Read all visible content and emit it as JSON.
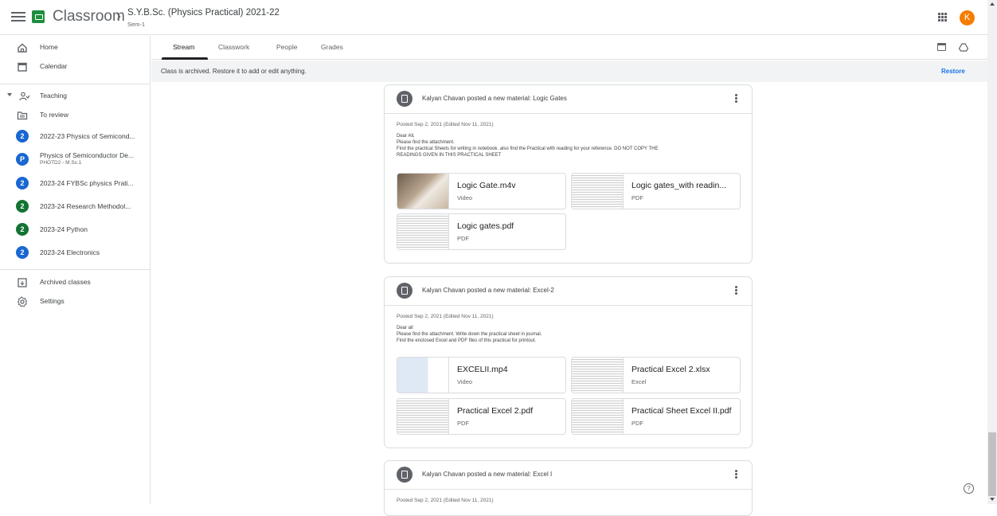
{
  "header": {
    "brand": "Classroom",
    "separator": "›",
    "class_title": "S.Y.B.Sc. (Physics Practical) 2021-22",
    "class_section": "Sem-1",
    "avatar_letter": "K",
    "avatar_color": "#f57c00"
  },
  "sidebar": {
    "home": "Home",
    "calendar": "Calendar",
    "teaching": "Teaching",
    "to_review": "To review",
    "classes": [
      {
        "badge": "2",
        "color": "#1967d2",
        "label": "2022-23 Physics of Semicond...",
        "sub": ""
      },
      {
        "badge": "P",
        "color": "#1967d2",
        "label": "Physics of Semiconductor De...",
        "sub": "PHOTD2 - M.Sc.1"
      },
      {
        "badge": "2",
        "color": "#1967d2",
        "label": "2023-24 FYBSc physics Prati...",
        "sub": ""
      },
      {
        "badge": "2",
        "color": "#137333",
        "label": "2023-24 Research Methodol...",
        "sub": ""
      },
      {
        "badge": "2",
        "color": "#137333",
        "label": "2023-24 Python",
        "sub": ""
      },
      {
        "badge": "2",
        "color": "#1967d2",
        "label": "2023-24 Electronics",
        "sub": ""
      }
    ],
    "archived": "Archived classes",
    "settings": "Settings"
  },
  "tabs": {
    "stream": "Stream",
    "classwork": "Classwork",
    "people": "People",
    "grades": "Grades"
  },
  "banner": {
    "text": "Class is archived. Restore it to add or edit anything.",
    "restore": "Restore"
  },
  "posts": [
    {
      "title": "Kalyan Chavan posted a new material: Logic Gates",
      "posted": "Posted Sep 2, 2021 (Edited Nov 11, 2021)",
      "body": [
        "Dear All,",
        "Please find the attachment.",
        "Find the practical Sheets for writing in notebook. also find the Practical with reading for your reference. DO NOT COPY THE",
        "READINGS GIVEN IN THIS PRACTICAL SHEET"
      ],
      "attachments": [
        {
          "name": "Logic Gate.m4v",
          "type": "Video"
        },
        {
          "name": "Logic gates_with readin...",
          "type": "PDF"
        },
        {
          "name": "Logic gates.pdf",
          "type": "PDF"
        }
      ]
    },
    {
      "title": "Kalyan Chavan posted a new material: Excel-2",
      "posted": "Posted Sep 2, 2021 (Edited Nov 11, 2021)",
      "body": [
        "Dear all",
        "Please find the attachment. Write down the practical sheet in journal.",
        "Find the enclosed Excel and PDF files of this practical for printout."
      ],
      "attachments": [
        {
          "name": "EXCELII.mp4",
          "type": "Video"
        },
        {
          "name": "Practical Excel 2.xlsx",
          "type": "Excel"
        },
        {
          "name": "Practical Excel 2.pdf",
          "type": "PDF"
        },
        {
          "name": "Practical Sheet Excel II.pdf",
          "type": "PDF"
        }
      ]
    },
    {
      "title": "Kalyan Chavan posted a new material: Excel I",
      "posted": "Posted Sep 2, 2021 (Edited Nov 11, 2021)"
    }
  ],
  "help": "?"
}
